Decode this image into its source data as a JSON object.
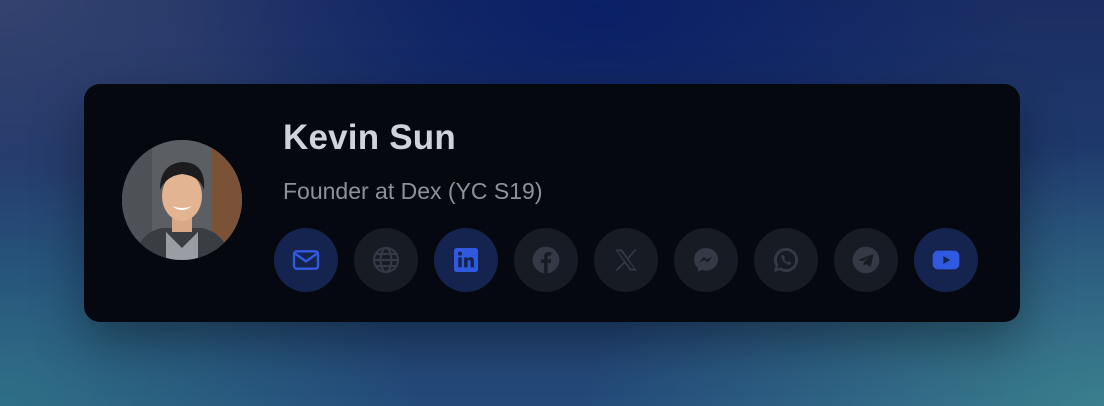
{
  "profile": {
    "name": "Kevin Sun",
    "title": "Founder at Dex (YC S19)"
  },
  "socials": [
    {
      "icon": "mail-icon",
      "active": true
    },
    {
      "icon": "globe-icon",
      "active": false
    },
    {
      "icon": "linkedin-icon",
      "active": true
    },
    {
      "icon": "facebook-icon",
      "active": false
    },
    {
      "icon": "x-icon",
      "active": false
    },
    {
      "icon": "messenger-icon",
      "active": false
    },
    {
      "icon": "whatsapp-icon",
      "active": false
    },
    {
      "icon": "telegram-icon",
      "active": false
    },
    {
      "icon": "youtube-icon",
      "active": true
    }
  ],
  "colors": {
    "card": "#05080f",
    "active_bg": "#15234f",
    "active_icon": "#2f5ae0",
    "inactive_bg": "#161b24",
    "inactive_icon": "#343a45"
  }
}
